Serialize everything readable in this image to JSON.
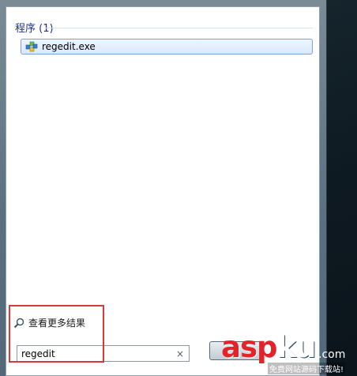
{
  "start_menu": {
    "section_title": "程序 (1)",
    "results": [
      {
        "label": "regedit.exe",
        "icon": "regedit-app-icon"
      }
    ],
    "see_more": {
      "label": "查看更多结果",
      "icon": "search-icon"
    },
    "search": {
      "value": "regedit",
      "clear_icon": "clear-icon",
      "clear_glyph": "×"
    }
  },
  "watermark": {
    "brand_red": "asp",
    "brand_white": "ku",
    "domain": ".com",
    "tagline": "免费网站源码下载站!"
  },
  "colors": {
    "section_title": "#1e3287",
    "highlight_border": "#d63a3a",
    "result_selected": "#d9e9fb"
  }
}
